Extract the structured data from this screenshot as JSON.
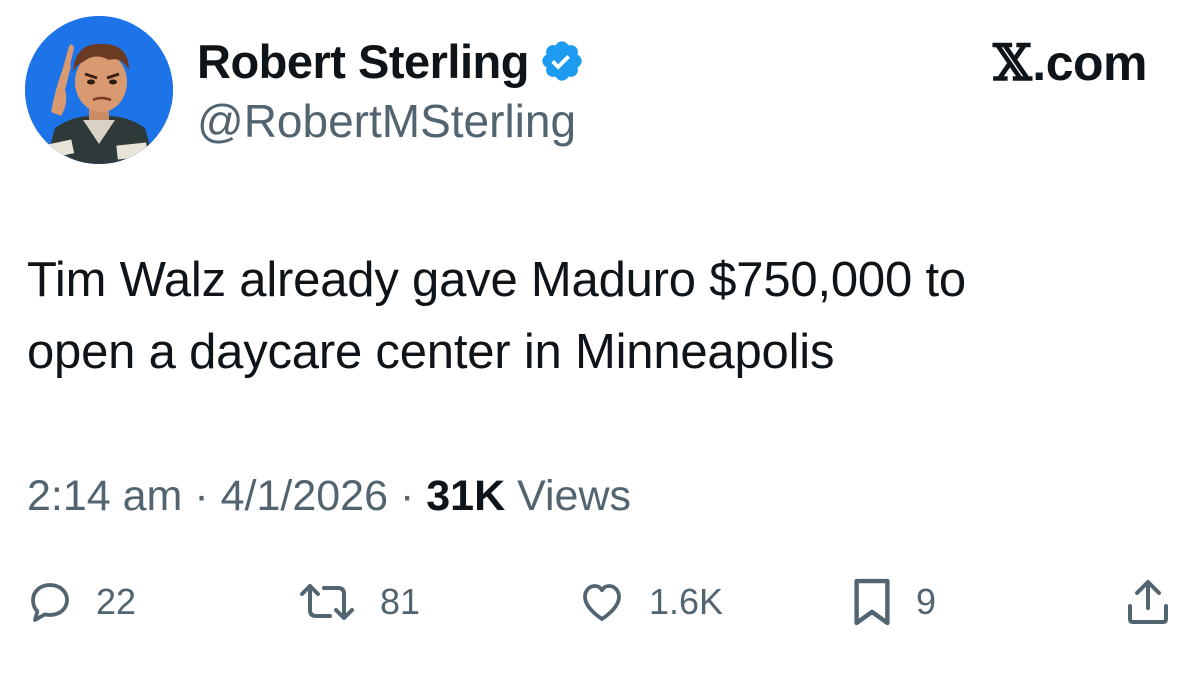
{
  "author": {
    "display_name": "Robert Sterling",
    "handle": "@RobertMSterling",
    "verified": true,
    "avatar_icon": "avatar-illustration"
  },
  "brand": {
    "x_mark": "𝕏",
    "domain": ".com"
  },
  "tweet": {
    "text_line1": "Tim Walz already gave Maduro $750,000 to",
    "text_line2": "open a daycare center in Minneapolis"
  },
  "meta": {
    "time": "2:14 am",
    "separator": "·",
    "date": "4/1/2026",
    "views_count": "31K",
    "views_label": "Views"
  },
  "actions": {
    "replies": "22",
    "reposts": "81",
    "likes": "1.6K",
    "bookmarks": "9"
  },
  "colors": {
    "text": "#0f1419",
    "secondary": "#536471",
    "verified_blue": "#1d9bf0",
    "background": "#ffffff"
  }
}
